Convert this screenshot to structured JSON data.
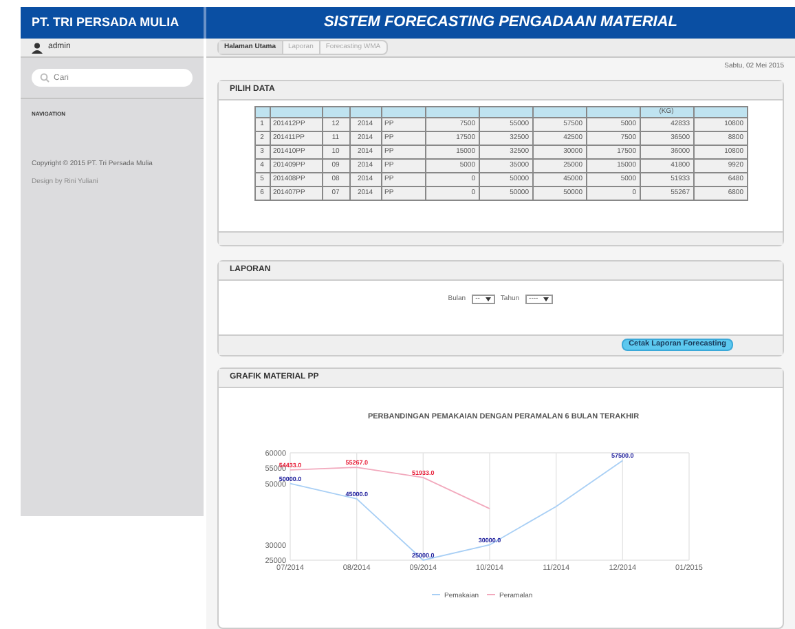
{
  "header": {
    "company": "PT. TRI PERSADA MULIA",
    "title": "SISTEM FORECASTING PENGADAAN MATERIAL"
  },
  "sidebar": {
    "user": "admin",
    "search": {
      "placeholder": "Cari"
    },
    "section_label": "NAVIGATION",
    "copyright": "Copyright © 2015 PT. Tri Persada Mulia",
    "credit": "Design by Rini Yuliani"
  },
  "breadcrumb": [
    {
      "label": "Halaman Utama",
      "selected": true
    },
    {
      "label": "Laporan",
      "selected": false
    },
    {
      "label": "Forecasting WMA",
      "selected": false
    }
  ],
  "date": "Sabtu, 02 Mei 2015",
  "pilih_data": {
    "title": "PILIH DATA",
    "columns": [
      "",
      "",
      "",
      "",
      "",
      "",
      "",
      "",
      "",
      "(KG)",
      ""
    ],
    "rows": [
      [
        "1",
        "201412PP",
        "12",
        "2014",
        "PP",
        "7500",
        "55000",
        "57500",
        "5000",
        "42833",
        "10800"
      ],
      [
        "2",
        "201411PP",
        "11",
        "2014",
        "PP",
        "17500",
        "32500",
        "42500",
        "7500",
        "36500",
        "8800"
      ],
      [
        "3",
        "201410PP",
        "10",
        "2014",
        "PP",
        "15000",
        "32500",
        "30000",
        "17500",
        "36000",
        "10800"
      ],
      [
        "4",
        "201409PP",
        "09",
        "2014",
        "PP",
        "5000",
        "35000",
        "25000",
        "15000",
        "41800",
        "9920"
      ],
      [
        "5",
        "201408PP",
        "08",
        "2014",
        "PP",
        "0",
        "50000",
        "45000",
        "5000",
        "51933",
        "6480"
      ],
      [
        "6",
        "201407PP",
        "07",
        "2014",
        "PP",
        "0",
        "50000",
        "50000",
        "0",
        "55267",
        "6800"
      ]
    ]
  },
  "laporan": {
    "title": "LAPORAN",
    "month_label": "Bulan",
    "month_value": "--",
    "year_label": "Tahun",
    "year_value": "----",
    "button": "Cetak Laporan Forecasting"
  },
  "grafik": {
    "title": "GRAFIK MATERIAL PP",
    "chart_data": {
      "type": "line",
      "title": "PERBANDINGAN PEMAKAIAN DENGAN PERAMALAN 6 BULAN TERAKHIR",
      "categories": [
        "07/2014",
        "08/2014",
        "09/2014",
        "10/2014",
        "11/2014",
        "12/2014",
        "01/2015"
      ],
      "ylim": [
        25000,
        60000
      ],
      "grid": true,
      "legend": true,
      "yticks": [
        25000,
        30000,
        50000,
        55000,
        60000
      ],
      "series": [
        {
          "name": "Pemakaian",
          "color": "#a8cff5",
          "values": [
            50000,
            45000,
            25000,
            30000,
            42500,
            57500,
            null
          ],
          "value_labels": [
            "50000.0",
            "45000.0",
            "25000.0",
            "30000.0",
            null,
            "57500.0",
            null
          ]
        },
        {
          "name": "Peramalan",
          "color": "#f2a9bd",
          "values": [
            54433,
            55267,
            51933,
            41800,
            null,
            null,
            null
          ],
          "value_labels": [
            "54433.0",
            "55267.0",
            "51933.0",
            null,
            null,
            null,
            null
          ]
        }
      ]
    }
  }
}
